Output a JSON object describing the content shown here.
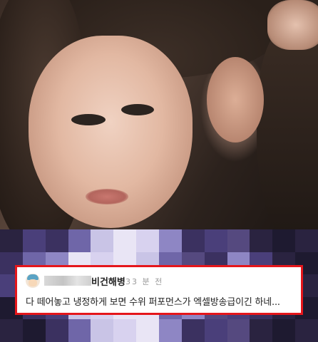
{
  "comment": {
    "username": "비건해병",
    "time": "33 분 전",
    "text": "다 떼어놓고 냉정하게 보면 수위 퍼포먼스가 엑셀방송급이긴 하네..."
  },
  "colors": {
    "highlight_border": "#e5161b",
    "background": "#ffffff"
  }
}
